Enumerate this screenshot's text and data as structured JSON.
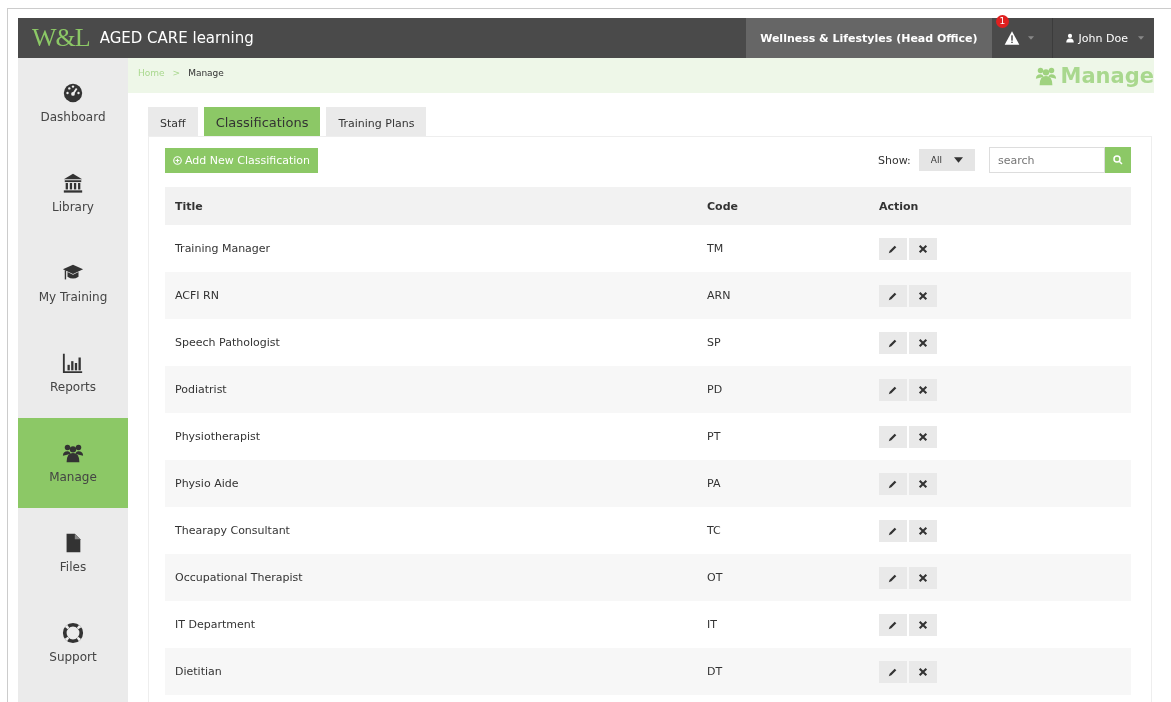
{
  "header": {
    "logo": "W&L",
    "app_name": "AGED CARE learning",
    "organisation": "Wellness & Lifestyles (Head Office)",
    "alert_count": "1",
    "user": "John Doe"
  },
  "sidebar": {
    "items": [
      {
        "label": "Dashboard",
        "selected": false
      },
      {
        "label": "Library",
        "selected": false
      },
      {
        "label": "My Training",
        "selected": false
      },
      {
        "label": "Reports",
        "selected": false
      },
      {
        "label": "Manage",
        "selected": true
      },
      {
        "label": "Files",
        "selected": false
      },
      {
        "label": "Support",
        "selected": false
      }
    ]
  },
  "breadcrumb": {
    "items": [
      "Home",
      "Manage"
    ],
    "separator": ">"
  },
  "page_title": "Manage",
  "tabs": [
    {
      "label": "Staff",
      "selected": false
    },
    {
      "label": "Classifications",
      "selected": true
    },
    {
      "label": "Training Plans",
      "selected": false
    }
  ],
  "add_button": "Add New Classification",
  "show": {
    "label": "Show:",
    "value": "All"
  },
  "search": {
    "placeholder": "search"
  },
  "table": {
    "columns": [
      "Title",
      "Code",
      "Action"
    ],
    "rows": [
      {
        "title": "Training Manager",
        "code": "TM"
      },
      {
        "title": "ACFI RN",
        "code": "ARN"
      },
      {
        "title": "Speech Pathologist",
        "code": "SP"
      },
      {
        "title": "Podiatrist",
        "code": "PD"
      },
      {
        "title": "Physiotherapist",
        "code": "PT"
      },
      {
        "title": "Physio Aide",
        "code": "PA"
      },
      {
        "title": "Thearapy Consultant",
        "code": "TC"
      },
      {
        "title": "Occupational Therapist",
        "code": "OT"
      },
      {
        "title": "IT Department",
        "code": "IT"
      },
      {
        "title": "Dietitian",
        "code": "DT"
      }
    ]
  }
}
